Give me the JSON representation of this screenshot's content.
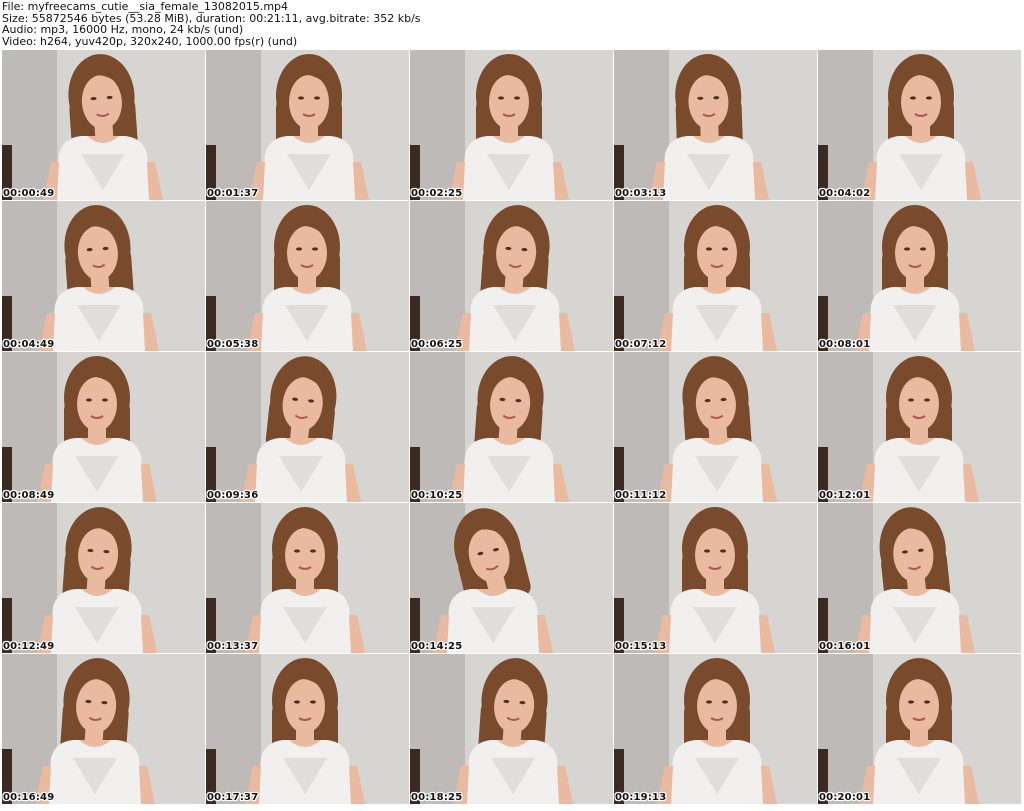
{
  "header": {
    "file": "File: myfreecams_cutie__sia_female_13082015.mp4",
    "size": "Size: 55872546 bytes (53.28 MiB), duration: 00:21:11, avg.bitrate: 352 kb/s",
    "audio": "Audio: mp3, 16000 Hz, mono, 24 kb/s (und)",
    "video": "Video: h264, yuv420p, 320x240, 1000.00 fps(r) (und)"
  },
  "thumbnails": [
    {
      "time": "00:00:49"
    },
    {
      "time": "00:01:37"
    },
    {
      "time": "00:02:25"
    },
    {
      "time": "00:03:13"
    },
    {
      "time": "00:04:02"
    },
    {
      "time": "00:04:49"
    },
    {
      "time": "00:05:38"
    },
    {
      "time": "00:06:25"
    },
    {
      "time": "00:07:12"
    },
    {
      "time": "00:08:01"
    },
    {
      "time": "00:08:49"
    },
    {
      "time": "00:09:36"
    },
    {
      "time": "00:10:25"
    },
    {
      "time": "00:11:12"
    },
    {
      "time": "00:12:01"
    },
    {
      "time": "00:12:49"
    },
    {
      "time": "00:13:37"
    },
    {
      "time": "00:14:25"
    },
    {
      "time": "00:15:13"
    },
    {
      "time": "00:16:01"
    },
    {
      "time": "00:16:49"
    },
    {
      "time": "00:17:37"
    },
    {
      "time": "00:18:25"
    },
    {
      "time": "00:19:13"
    },
    {
      "time": "00:20:01"
    }
  ],
  "colors": {
    "wall": "#d7d5d2",
    "wall_shadow": "#a9a4a1",
    "hair": "#7a4a2c",
    "skin": "#e9b9a0",
    "shirt": "#f1f0ee"
  }
}
